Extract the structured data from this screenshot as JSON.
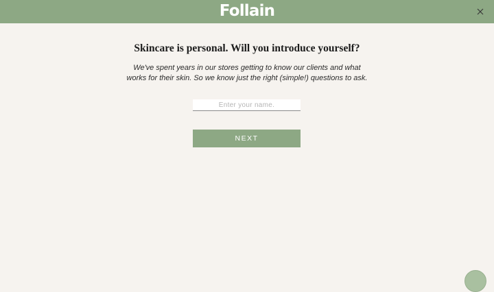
{
  "header": {
    "logo_text": "Follain",
    "close_icon": "close-icon"
  },
  "main": {
    "headline": "Skincare is personal. Will you introduce yourself?",
    "subtext_line1": "We've spent years in our stores getting to know our clients and what",
    "subtext_line2": "works for their skin. So we know just the right (simple!) questions to ask.",
    "name_input": {
      "value": "",
      "placeholder": "Enter your name."
    },
    "next_label": "NEXT"
  },
  "chat": {
    "icon": "chat-bubble-icon"
  },
  "colors": {
    "brand_green": "#8da884",
    "background": "#f6f3ef"
  }
}
